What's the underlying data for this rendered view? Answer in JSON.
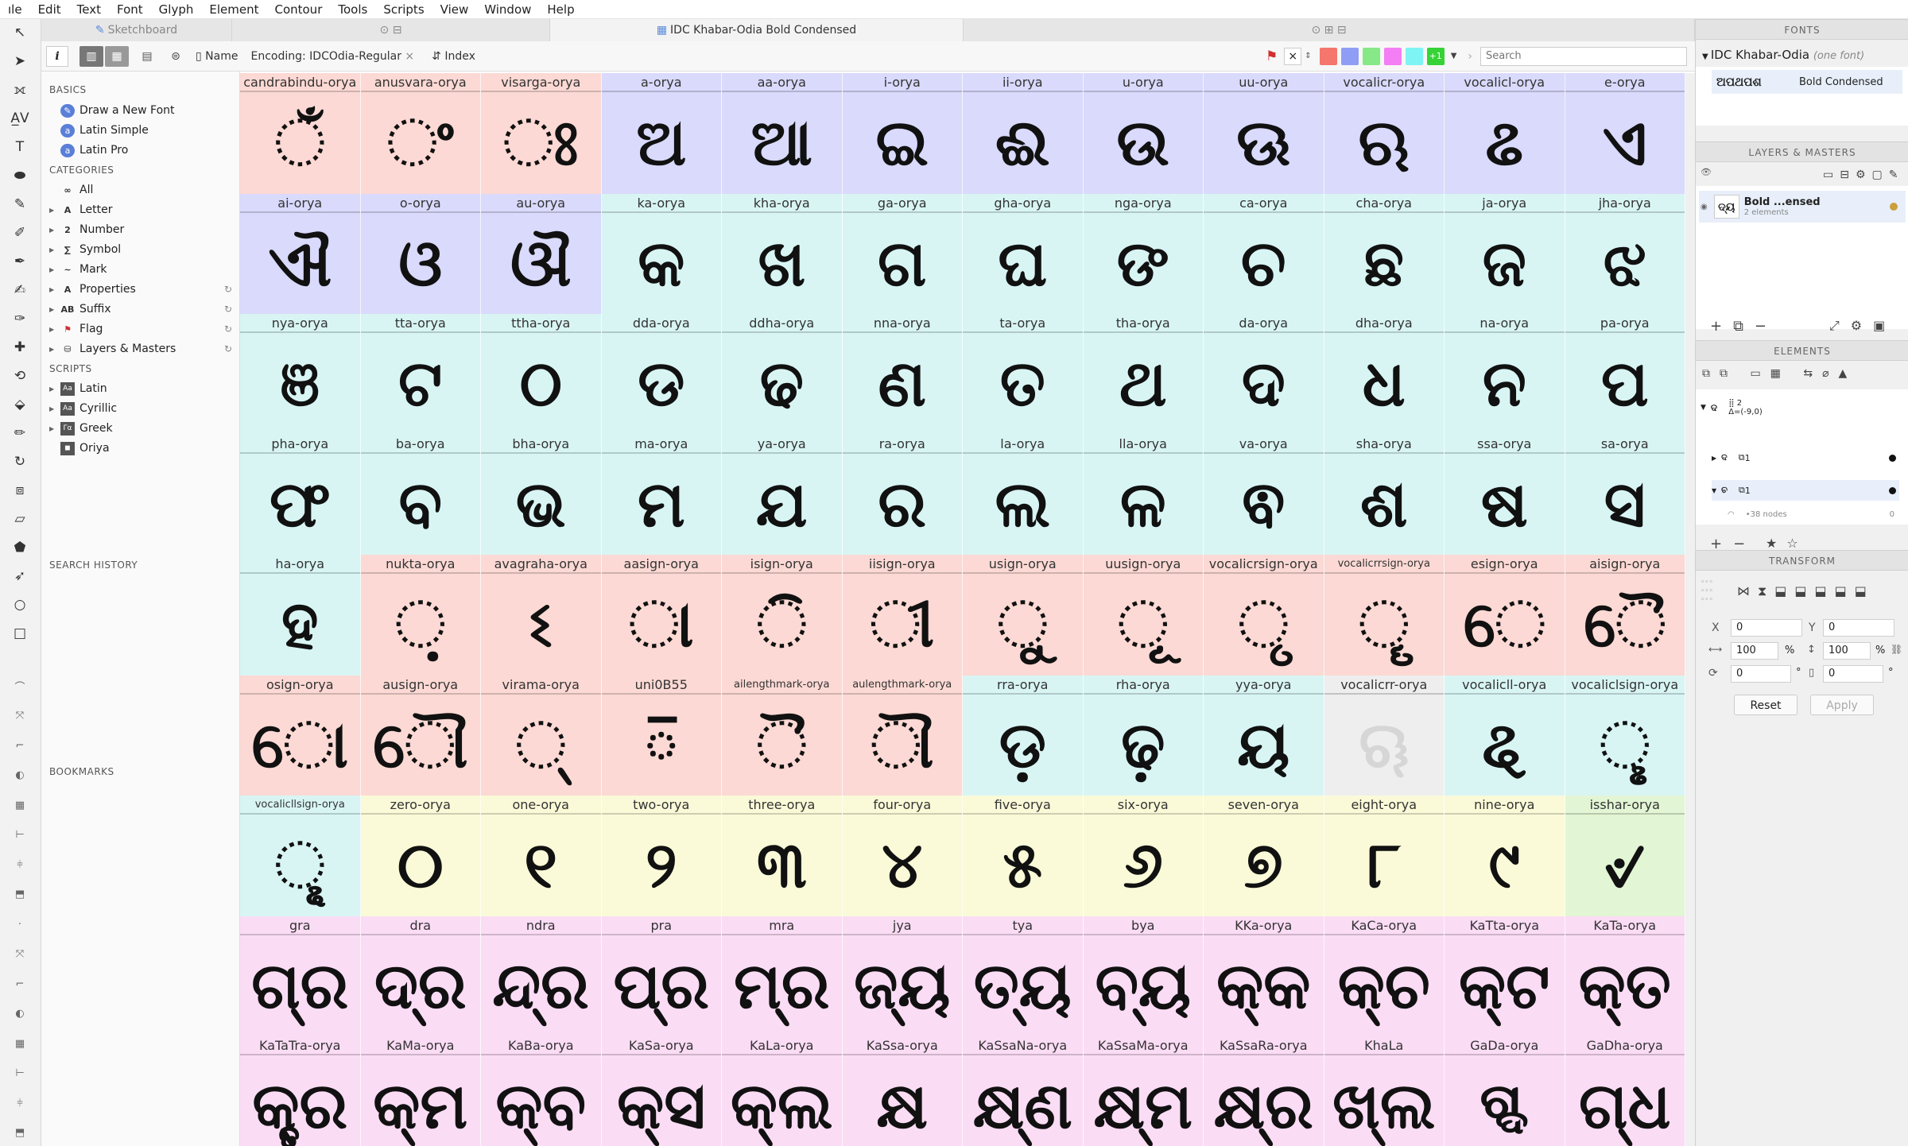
{
  "menu": [
    "ıle",
    "Edit",
    "Text",
    "Font",
    "Glyph",
    "Element",
    "Contour",
    "Tools",
    "Scripts",
    "View",
    "Window",
    "Help"
  ],
  "tabs": {
    "t1": "Sketchboard",
    "t2": "⊙ ⊟",
    "t3": "IDC Khabar-Odia Bold Condensed",
    "t4": "⊙ ⊞ ⊟"
  },
  "toolbar": {
    "info": "i",
    "name_label": "Name",
    "encoding_label": "Encoding:",
    "encoding_value": "IDCOdia-Regular",
    "encoding_clear": "×",
    "index_label": "Index",
    "search_placeholder": "Search",
    "filter_clear": "×",
    "filter_count": "+1",
    "swatch_colors": [
      "#f4766d",
      "#8f9ef4",
      "#86e886",
      "#f47ef4",
      "#7ef4f4",
      "#36d236"
    ]
  },
  "sidebar": {
    "basics_h": "BASICS",
    "basics": [
      "Draw a New Font",
      "Latin Simple",
      "Latin Pro"
    ],
    "categories_h": "CATEGORIES",
    "categories": [
      "All",
      "Letter",
      "Number",
      "Symbol",
      "Mark",
      "Properties",
      "Suffix",
      "Flag",
      "Layers & Masters"
    ],
    "scripts_h": "SCRIPTS",
    "scripts": [
      "Latin",
      "Cyrillic",
      "Greek",
      "Oriya"
    ],
    "search_history_h": "SEARCH HISTORY",
    "bookmarks_h": "BOOKMARKS"
  },
  "glyphs": [
    {
      "n": "candrabindu-orya",
      "g": "ଁ",
      "c": "#fcd9d4"
    },
    {
      "n": "anusvara-orya",
      "g": "ଂ",
      "c": "#fcd9d4"
    },
    {
      "n": "visarga-orya",
      "g": "ଃ",
      "c": "#fcd9d4"
    },
    {
      "n": "a-orya",
      "g": "ଅ",
      "c": "#d9dafc"
    },
    {
      "n": "aa-orya",
      "g": "ଆ",
      "c": "#d9dafc"
    },
    {
      "n": "i-orya",
      "g": "ଇ",
      "c": "#d9dafc"
    },
    {
      "n": "ii-orya",
      "g": "ଈ",
      "c": "#d9dafc"
    },
    {
      "n": "u-orya",
      "g": "ଉ",
      "c": "#d9dafc"
    },
    {
      "n": "uu-orya",
      "g": "ଊ",
      "c": "#d9dafc"
    },
    {
      "n": "vocalicr-orya",
      "g": "ଋ",
      "c": "#d9dafc"
    },
    {
      "n": "vocalicl-orya",
      "g": "ଌ",
      "c": "#d9dafc"
    },
    {
      "n": "e-orya",
      "g": "ଏ",
      "c": "#d9dafc"
    },
    {
      "n": "ai-orya",
      "g": "ଐ",
      "c": "#d9dafc"
    },
    {
      "n": "o-orya",
      "g": "ଓ",
      "c": "#d9dafc"
    },
    {
      "n": "au-orya",
      "g": "ଔ",
      "c": "#d9dafc"
    },
    {
      "n": "ka-orya",
      "g": "କ",
      "c": "#d8f5f4"
    },
    {
      "n": "kha-orya",
      "g": "ଖ",
      "c": "#d8f5f4"
    },
    {
      "n": "ga-orya",
      "g": "ଗ",
      "c": "#d8f5f4"
    },
    {
      "n": "gha-orya",
      "g": "ଘ",
      "c": "#d8f5f4"
    },
    {
      "n": "nga-orya",
      "g": "ଙ",
      "c": "#d8f5f4"
    },
    {
      "n": "ca-orya",
      "g": "ଚ",
      "c": "#d8f5f4"
    },
    {
      "n": "cha-orya",
      "g": "ଛ",
      "c": "#d8f5f4"
    },
    {
      "n": "ja-orya",
      "g": "ଜ",
      "c": "#d8f5f4"
    },
    {
      "n": "jha-orya",
      "g": "ଝ",
      "c": "#d8f5f4"
    },
    {
      "n": "nya-orya",
      "g": "ଞ",
      "c": "#d8f5f4"
    },
    {
      "n": "tta-orya",
      "g": "ଟ",
      "c": "#d8f5f4"
    },
    {
      "n": "ttha-orya",
      "g": "ଠ",
      "c": "#d8f5f4"
    },
    {
      "n": "dda-orya",
      "g": "ଡ",
      "c": "#d8f5f4"
    },
    {
      "n": "ddha-orya",
      "g": "ଢ",
      "c": "#d8f5f4"
    },
    {
      "n": "nna-orya",
      "g": "ଣ",
      "c": "#d8f5f4"
    },
    {
      "n": "ta-orya",
      "g": "ତ",
      "c": "#d8f5f4"
    },
    {
      "n": "tha-orya",
      "g": "ଥ",
      "c": "#d8f5f4"
    },
    {
      "n": "da-orya",
      "g": "ଦ",
      "c": "#d8f5f4"
    },
    {
      "n": "dha-orya",
      "g": "ଧ",
      "c": "#d8f5f4"
    },
    {
      "n": "na-orya",
      "g": "ନ",
      "c": "#d8f5f4"
    },
    {
      "n": "pa-orya",
      "g": "ପ",
      "c": "#d8f5f4"
    },
    {
      "n": "pha-orya",
      "g": "ଫ",
      "c": "#d8f5f4"
    },
    {
      "n": "ba-orya",
      "g": "ବ",
      "c": "#d8f5f4"
    },
    {
      "n": "bha-orya",
      "g": "ଭ",
      "c": "#d8f5f4"
    },
    {
      "n": "ma-orya",
      "g": "ମ",
      "c": "#d8f5f4"
    },
    {
      "n": "ya-orya",
      "g": "ଯ",
      "c": "#d8f5f4"
    },
    {
      "n": "ra-orya",
      "g": "ର",
      "c": "#d8f5f4"
    },
    {
      "n": "la-orya",
      "g": "ଲ",
      "c": "#d8f5f4"
    },
    {
      "n": "lla-orya",
      "g": "ଳ",
      "c": "#d8f5f4"
    },
    {
      "n": "va-orya",
      "g": "ଵ",
      "c": "#d8f5f4"
    },
    {
      "n": "sha-orya",
      "g": "ଶ",
      "c": "#d8f5f4"
    },
    {
      "n": "ssa-orya",
      "g": "ଷ",
      "c": "#d8f5f4"
    },
    {
      "n": "sa-orya",
      "g": "ସ",
      "c": "#d8f5f4"
    },
    {
      "n": "ha-orya",
      "g": "ହ",
      "c": "#d8f5f4"
    },
    {
      "n": "nukta-orya",
      "g": "଼",
      "c": "#fcd9d4"
    },
    {
      "n": "avagraha-orya",
      "g": "ଽ",
      "c": "#fcd9d4"
    },
    {
      "n": "aasign-orya",
      "g": "ା",
      "c": "#fcd9d4"
    },
    {
      "n": "isign-orya",
      "g": "ି",
      "c": "#fcd9d4"
    },
    {
      "n": "iisign-orya",
      "g": "ୀ",
      "c": "#fcd9d4"
    },
    {
      "n": "usign-orya",
      "g": "ୁ",
      "c": "#fcd9d4"
    },
    {
      "n": "uusign-orya",
      "g": "ୂ",
      "c": "#fcd9d4"
    },
    {
      "n": "vocalicrsign-orya",
      "g": "ୃ",
      "c": "#fcd9d4"
    },
    {
      "n": "vocalicrrsign-orya",
      "g": "ୄ",
      "c": "#fcd9d4",
      "sm": true
    },
    {
      "n": "esign-orya",
      "g": "େ",
      "c": "#fcd9d4"
    },
    {
      "n": "aisign-orya",
      "g": "ୈ",
      "c": "#fcd9d4"
    },
    {
      "n": "osign-orya",
      "g": "ୋ",
      "c": "#fcd9d4"
    },
    {
      "n": "ausign-orya",
      "g": "ୌ",
      "c": "#fcd9d4"
    },
    {
      "n": "virama-orya",
      "g": "୍",
      "c": "#fcd9d4"
    },
    {
      "n": "uni0B55",
      "g": "୕",
      "c": "#fcd9d4"
    },
    {
      "n": "ailengthmark-orya",
      "g": "ୖ",
      "c": "#fcd9d4",
      "sm": true
    },
    {
      "n": "aulengthmark-orya",
      "g": "ୗ",
      "c": "#fcd9d4",
      "sm": true
    },
    {
      "n": "rra-orya",
      "g": "ଡ଼",
      "c": "#d8f5f4"
    },
    {
      "n": "rha-orya",
      "g": "ଢ଼",
      "c": "#d8f5f4"
    },
    {
      "n": "yya-orya",
      "g": "ୟ",
      "c": "#d8f5f4"
    },
    {
      "n": "vocalicrr-orya",
      "g": "ୠ",
      "c": "#eeeeee",
      "ghost": true
    },
    {
      "n": "vocalicll-orya",
      "g": "ୡ",
      "c": "#d8f5f4"
    },
    {
      "n": "vocaliclsign-orya",
      "g": "ୢ",
      "c": "#d8f5f4"
    },
    {
      "n": "vocalicllsign-orya",
      "g": "ୣ",
      "c": "#d8f5f4",
      "sm": true
    },
    {
      "n": "zero-orya",
      "g": "୦",
      "c": "#fafad8"
    },
    {
      "n": "one-orya",
      "g": "୧",
      "c": "#fafad8"
    },
    {
      "n": "two-orya",
      "g": "୨",
      "c": "#fafad8"
    },
    {
      "n": "three-orya",
      "g": "୩",
      "c": "#fafad8"
    },
    {
      "n": "four-orya",
      "g": "୪",
      "c": "#fafad8"
    },
    {
      "n": "five-orya",
      "g": "୫",
      "c": "#fafad8"
    },
    {
      "n": "six-orya",
      "g": "୬",
      "c": "#fafad8"
    },
    {
      "n": "seven-orya",
      "g": "୭",
      "c": "#fafad8"
    },
    {
      "n": "eight-orya",
      "g": "୮",
      "c": "#fafad8"
    },
    {
      "n": "nine-orya",
      "g": "୯",
      "c": "#fafad8"
    },
    {
      "n": "isshar-orya",
      "g": "୰",
      "c": "#e2f5d4"
    },
    {
      "n": "gra",
      "g": "ଗ୍ର",
      "c": "#fbdcf5"
    },
    {
      "n": "dra",
      "g": "ଦ୍ର",
      "c": "#fbdcf5"
    },
    {
      "n": "ndra",
      "g": "ନ୍ଦ୍ର",
      "c": "#fbdcf5"
    },
    {
      "n": "pra",
      "g": "ପ୍ର",
      "c": "#fbdcf5"
    },
    {
      "n": "mra",
      "g": "ମ୍ର",
      "c": "#fbdcf5"
    },
    {
      "n": "jya",
      "g": "ଜ୍ୟ",
      "c": "#fbdcf5"
    },
    {
      "n": "tya",
      "g": "ତ୍ୟ",
      "c": "#fbdcf5"
    },
    {
      "n": "bya",
      "g": "ବ୍ୟ",
      "c": "#fbdcf5"
    },
    {
      "n": "KKa-orya",
      "g": "କ୍କ",
      "c": "#fbdcf5"
    },
    {
      "n": "KaCa-orya",
      "g": "କ୍ଚ",
      "c": "#fbdcf5"
    },
    {
      "n": "KaTta-orya",
      "g": "କ୍ଟ",
      "c": "#fbdcf5"
    },
    {
      "n": "KaTa-orya",
      "g": "କ୍ତ",
      "c": "#fbdcf5"
    },
    {
      "n": "KaTaTra-orya",
      "g": "କ୍ତ୍ର",
      "c": "#fbdcf5"
    },
    {
      "n": "KaMa-orya",
      "g": "କ୍ମ",
      "c": "#fbdcf5"
    },
    {
      "n": "KaBa-orya",
      "g": "କ୍ବ",
      "c": "#fbdcf5"
    },
    {
      "n": "KaSa-orya",
      "g": "କ୍ସ",
      "c": "#fbdcf5"
    },
    {
      "n": "KaLa-orya",
      "g": "କ୍ଲ",
      "c": "#fbdcf5"
    },
    {
      "n": "KaSsa-orya",
      "g": "କ୍ଷ",
      "c": "#fbdcf5"
    },
    {
      "n": "KaSsaNa-orya",
      "g": "କ୍ଷ୍ଣ",
      "c": "#fbdcf5"
    },
    {
      "n": "KaSsaMa-orya",
      "g": "କ୍ଷ୍ମ",
      "c": "#fbdcf5"
    },
    {
      "n": "KaSsaRa-orya",
      "g": "କ୍ଷ୍ର",
      "c": "#fbdcf5"
    },
    {
      "n": "KhaLa",
      "g": "ଖ୍ଲ",
      "c": "#fbdcf5"
    },
    {
      "n": "GaDa-orya",
      "g": "ଗ୍ଦ",
      "c": "#fbdcf5"
    },
    {
      "n": "GaDha-orya",
      "g": "ଗ୍ଧ",
      "c": "#fbdcf5"
    }
  ],
  "right": {
    "fonts_h": "FONTS",
    "font_name": "IDC Khabar-Odia",
    "font_count": "(one font)",
    "style_sample": "ଅପଥପଶ",
    "style_name": "Bold Condensed",
    "layers_h": "LAYERS & MASTERS",
    "layer_name": "Bold ...ensed",
    "layer_sub": "2 elements",
    "layer_glyph": "ଦ୍ୟ",
    "elements_h": "ELEMENTS",
    "el_group_count": "2",
    "el_group_delta": "Δ=(-9,0)",
    "el1": "1",
    "el2": "1",
    "el_nodes": "38 nodes",
    "el_nodes_val": "0",
    "transform_h": "TRANSFORM",
    "x_label": "X",
    "x_val": "0",
    "y_label": "Y",
    "y_val": "0",
    "w_val": "100",
    "w_unit": "%",
    "h_val": "100",
    "h_unit": "%",
    "rot_val": "0",
    "rot_unit": "°",
    "skew_val": "0",
    "skew_unit": "°",
    "reset": "Reset",
    "apply": "Apply"
  }
}
